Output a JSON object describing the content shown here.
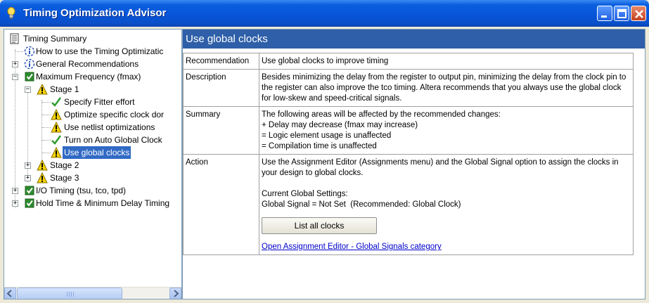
{
  "window": {
    "title": "Timing Optimization Advisor"
  },
  "tree": {
    "items": [
      {
        "label": "Timing Summary",
        "icon": "document-icon"
      },
      {
        "label": "How to use the Timing Optimizatic",
        "icon": "info-icon"
      },
      {
        "label": "General Recommendations",
        "icon": "info-icon"
      },
      {
        "label": "Maximum Frequency (fmax)",
        "icon": "checkbox-icon"
      },
      {
        "label": "Stage 1",
        "icon": "warning-icon"
      },
      {
        "label": "Specify Fitter effort",
        "icon": "checkmark-icon"
      },
      {
        "label": "Optimize specific clock dor",
        "icon": "warning-icon"
      },
      {
        "label": "Use netlist optimizations",
        "icon": "warning-icon"
      },
      {
        "label": "Turn on Auto Global Clock",
        "icon": "checkmark-icon"
      },
      {
        "label": "Use global clocks",
        "icon": "warning-icon"
      },
      {
        "label": "Stage 2",
        "icon": "warning-icon"
      },
      {
        "label": "Stage 3",
        "icon": "warning-icon"
      },
      {
        "label": "I/O Timing (tsu, tco, tpd)",
        "icon": "checkbox-icon"
      },
      {
        "label": "Hold Time & Minimum Delay Timing",
        "icon": "checkbox-icon"
      }
    ],
    "selected": "Use global clocks"
  },
  "content": {
    "header": "Use global clocks",
    "rows": {
      "recommendation": {
        "key": "Recommendation",
        "value": "Use global clocks to improve timing"
      },
      "description": {
        "key": "Description",
        "value": "Besides minimizing the delay from the register to output pin, minimizing the delay from the clock pin to the register can also improve the tco timing. Altera recommends that you always use the global clock for low-skew and speed-critical signals."
      },
      "summary": {
        "key": "Summary",
        "lines": [
          "The following areas will be affected by the recommended changes:",
          "+ Delay may decrease (fmax may increase)",
          "= Logic element usage is unaffected",
          "= Compilation time is unaffected"
        ]
      },
      "action": {
        "key": "Action",
        "intro": "Use the Assignment Editor (Assignments menu) and the Global Signal option to assign the clocks in your design to global clocks.",
        "settings_title": "Current Global Settings:",
        "settings_value": "Global Signal = Not Set  (Recommended: Global Clock)",
        "button_label": "List all clocks",
        "link_label": "Open Assignment Editor - Global Signals category"
      }
    }
  },
  "colors": {
    "titlebar": "#0854D8",
    "header": "#2E5FA8",
    "selection": "#316AC5",
    "warning": "#F5D400",
    "check": "#2E9C2E",
    "link": "#0000CC"
  }
}
